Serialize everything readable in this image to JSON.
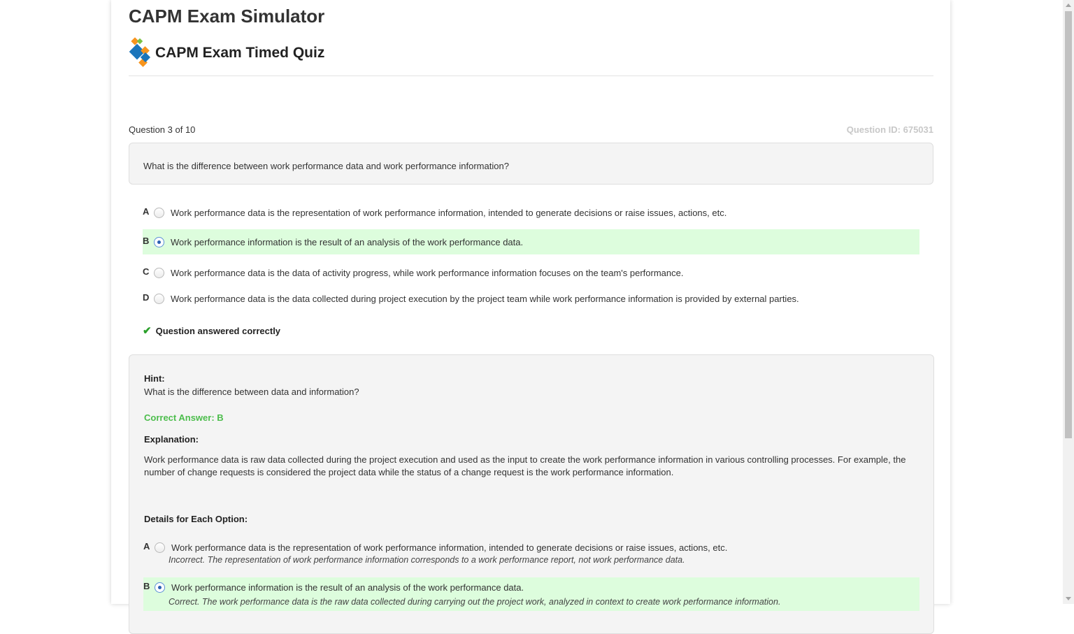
{
  "app": {
    "title": "CAPM Exam Simulator"
  },
  "quiz": {
    "title": "CAPM Exam Timed Quiz"
  },
  "question": {
    "counter": "Question 3 of 10",
    "id_label": "Question ID: 675031",
    "text": "What is the difference between work performance data and work performance information?",
    "selected": "B",
    "options": [
      {
        "letter": "A",
        "text": "Work performance data is the representation of work performance information, intended to generate decisions or raise issues, actions, etc."
      },
      {
        "letter": "B",
        "text": "Work performance information is the result of an analysis of the work performance data."
      },
      {
        "letter": "C",
        "text": "Work performance data is the data of activity progress, while work performance information focuses on the team's performance."
      },
      {
        "letter": "D",
        "text": "Work performance data is the data collected during project execution by the project team while work performance information is provided by external parties."
      }
    ],
    "status": "Question answered correctly"
  },
  "feedback": {
    "hint_label": "Hint:",
    "hint_text": "What is the difference between data and information?",
    "correct_answer": "Correct Answer: B",
    "explanation_label": "Explanation:",
    "explanation_text": "Work performance data is raw data collected during the project execution and used as the input to create the work performance information in various controlling processes. For example, the number of change requests is considered the project data while the status of a change request is the work performance information.",
    "details_label": "Details for Each Option:",
    "details": [
      {
        "letter": "A",
        "text": "Work performance data is the representation of work performance information, intended to generate decisions or raise issues, actions, etc.",
        "note": "Incorrect. The representation of work performance information corresponds to a work performance report, not work performance data."
      },
      {
        "letter": "B",
        "text": "Work performance information is the result of an analysis of the work performance data.",
        "note": "Correct. The work performance data is the raw data collected during carrying out the project work, analyzed in context to create work performance information."
      }
    ]
  },
  "colors": {
    "selected_bg": "#ddfddd",
    "correct_green": "#4cbd4c",
    "check_green": "#2aa02a",
    "id_gray": "#c8c8c8"
  },
  "icons": {
    "logo": "diamond-logo-icon",
    "check": "checkmark-icon"
  }
}
